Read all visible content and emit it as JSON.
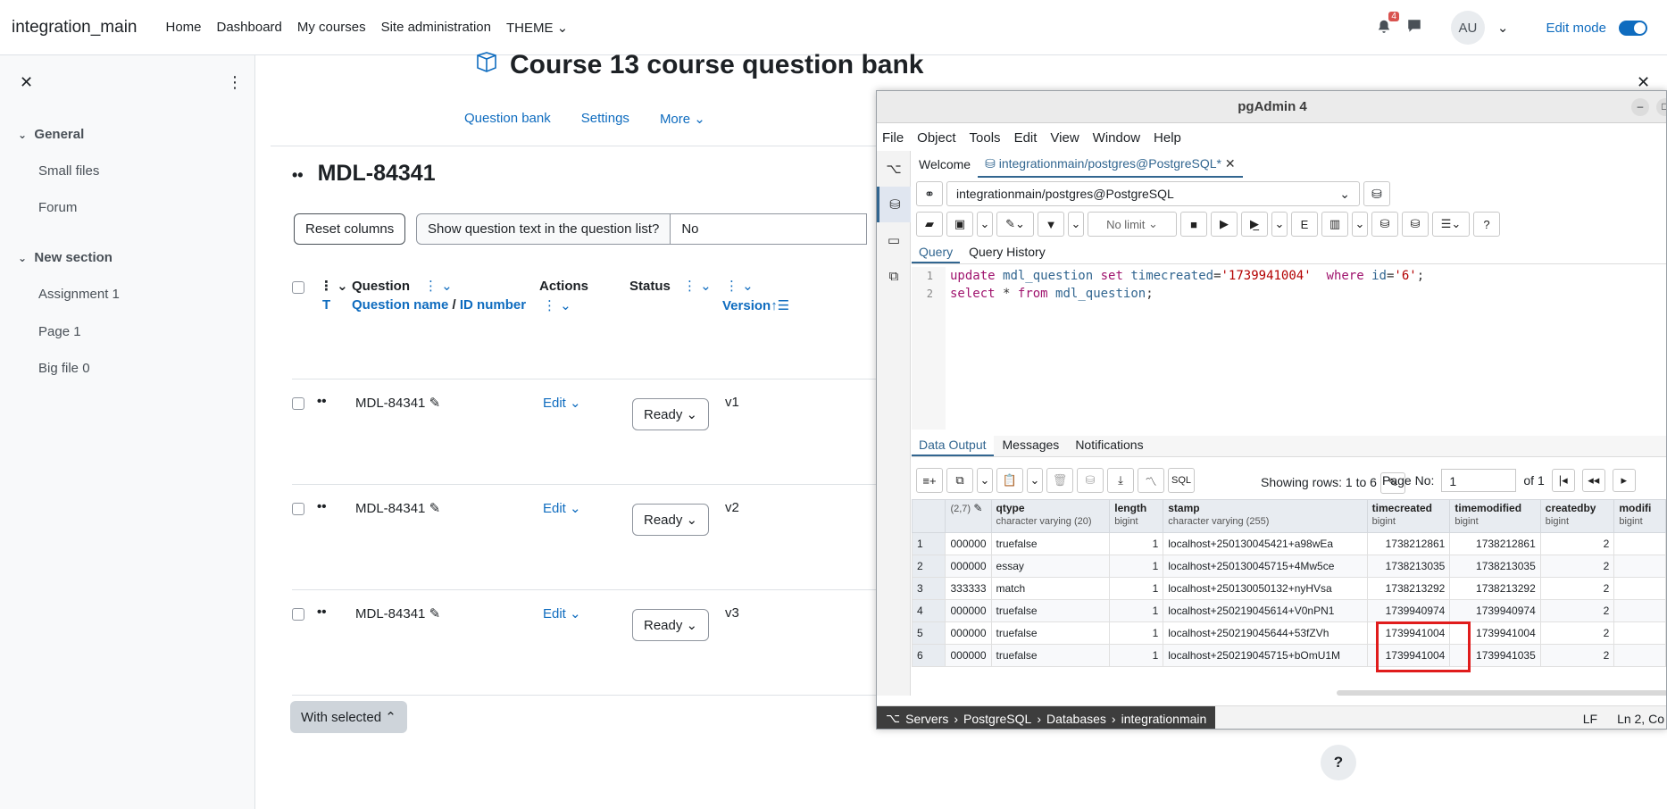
{
  "nav": {
    "brand": "integration_main",
    "links": [
      "Home",
      "Dashboard",
      "My courses",
      "Site administration",
      "THEME"
    ],
    "notif_count": "4",
    "avatar": "AU",
    "edit_mode": "Edit mode"
  },
  "drawer": {
    "sections": [
      {
        "title": "General",
        "items": [
          "Small files",
          "Forum"
        ]
      },
      {
        "title": "New section",
        "items": [
          "Assignment 1",
          "Page 1",
          "Big file 0"
        ]
      }
    ]
  },
  "page": {
    "title": "Course 13 course question bank",
    "subnav": [
      "Question bank",
      "Settings",
      "More"
    ],
    "heading": "MDL-84341",
    "reset_columns": "Reset columns",
    "show_text_label": "Show question text in the question list?",
    "show_text_value": "No",
    "columns": {
      "t": "T",
      "question": "Question",
      "question_name": "Question name",
      "id_number": "ID number",
      "actions": "Actions",
      "status": "Status",
      "version": "Version"
    },
    "rows": [
      {
        "name": "MDL-84341",
        "edit": "Edit",
        "status": "Ready",
        "version": "v1"
      },
      {
        "name": "MDL-84341",
        "edit": "Edit",
        "status": "Ready",
        "version": "v2"
      },
      {
        "name": "MDL-84341",
        "edit": "Edit",
        "status": "Ready",
        "version": "v3"
      }
    ],
    "with_selected": "With selected",
    "help": "?"
  },
  "pgadmin": {
    "title": "pgAdmin 4",
    "menu": [
      "File",
      "Object",
      "Tools",
      "Edit",
      "View",
      "Window",
      "Help"
    ],
    "tabs": {
      "welcome": "Welcome",
      "query_tab": "integrationmain/postgres@PostgreSQL*"
    },
    "connection": "integrationmain/postgres@PostgreSQL",
    "limit": "No limit",
    "query_tabs": [
      "Query",
      "Query History"
    ],
    "sql": {
      "line1": {
        "kw1": "update",
        "t1": "mdl_question",
        "kw2": "set",
        "c1": "timecreated",
        "v1": "'1739941004'",
        "kw3": "where",
        "c2": "id",
        "v2": "'6'"
      },
      "line2": {
        "kw1": "select",
        "star": "*",
        "kw2": "from",
        "t1": "mdl_question"
      }
    },
    "output_tabs": [
      "Data Output",
      "Messages",
      "Notifications"
    ],
    "rows_info": "Showing rows: 1 to 6",
    "page_label": "Page No:",
    "page_no": "1",
    "page_of": "of 1",
    "table": {
      "columns": [
        {
          "name": "",
          "type": "(2,7)"
        },
        {
          "name": "qtype",
          "type": "character varying (20)"
        },
        {
          "name": "length",
          "type": "bigint"
        },
        {
          "name": "stamp",
          "type": "character varying (255)"
        },
        {
          "name": "timecreated",
          "type": "bigint"
        },
        {
          "name": "timemodified",
          "type": "bigint"
        },
        {
          "name": "createdby",
          "type": "bigint"
        },
        {
          "name": "modifi",
          "type": "bigint"
        }
      ],
      "rows": [
        [
          "1",
          "000000",
          "truefalse",
          "1",
          "localhost+250130045421+a98wEa",
          "1738212861",
          "1738212861",
          "2"
        ],
        [
          "2",
          "000000",
          "essay",
          "1",
          "localhost+250130045715+4Mw5ce",
          "1738213035",
          "1738213035",
          "2"
        ],
        [
          "3",
          "333333",
          "match",
          "1",
          "localhost+250130050132+nyHVsa",
          "1738213292",
          "1738213292",
          "2"
        ],
        [
          "4",
          "000000",
          "truefalse",
          "1",
          "localhost+250219045614+V0nPN1",
          "1739940974",
          "1739940974",
          "2"
        ],
        [
          "5",
          "000000",
          "truefalse",
          "1",
          "localhost+250219045644+53fZVh",
          "1739941004",
          "1739941004",
          "2"
        ],
        [
          "6",
          "000000",
          "truefalse",
          "1",
          "localhost+250219045715+bOmU1M",
          "1739941004",
          "1739941035",
          "2"
        ]
      ]
    },
    "breadcrumb": [
      "Servers",
      "PostgreSQL",
      "Databases",
      "integrationmain"
    ],
    "line_ending": "LF",
    "cursor": "Ln 2, Co"
  }
}
